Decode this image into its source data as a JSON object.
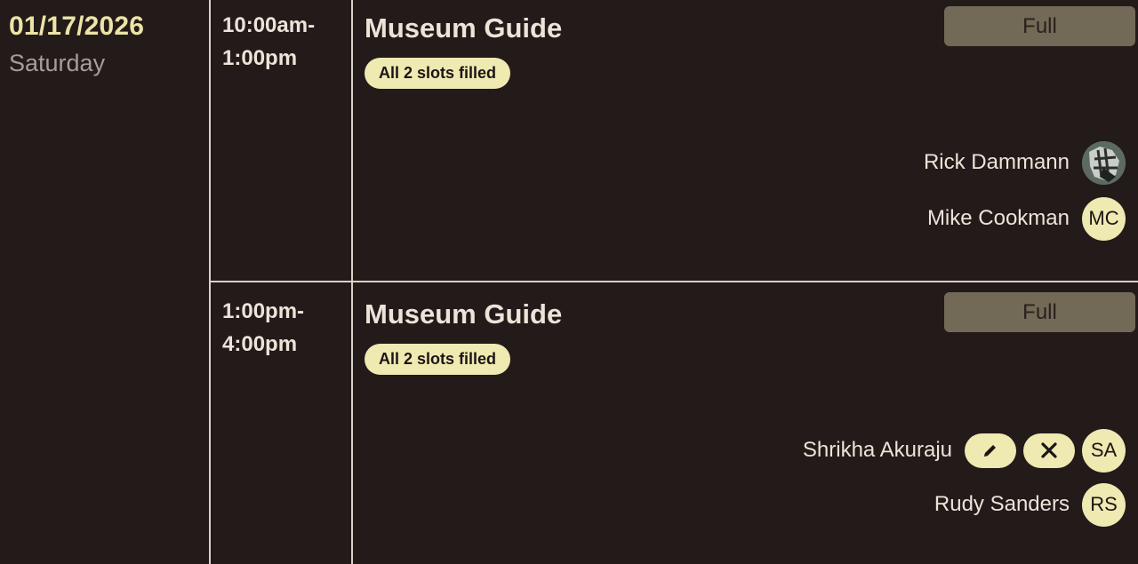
{
  "date": {
    "value": "01/17/2026",
    "weekday": "Saturday"
  },
  "shifts": [
    {
      "time": "10:00am-\n1:00pm",
      "title": "Museum Guide",
      "status_pill": "All 2 slots filled",
      "action_label": "Full",
      "volunteers": [
        {
          "name": "Rick Dammann",
          "initials": "",
          "avatar": "photo"
        },
        {
          "name": "Mike Cookman",
          "initials": "MC"
        }
      ]
    },
    {
      "time": "1:00pm-\n4:00pm",
      "title": "Museum Guide",
      "status_pill": "All 2 slots filled",
      "action_label": "Full",
      "volunteers": [
        {
          "name": "Shrikha Akuraju",
          "initials": "SA",
          "actions": [
            "edit-icon",
            "close-icon"
          ]
        },
        {
          "name": "Rudy Sanders",
          "initials": "RS"
        }
      ]
    }
  ],
  "colors": {
    "background": "#231a1a",
    "accent": "#efe9b2",
    "date_text": "#ece3a6",
    "button": "#726a57",
    "divider": "#d8d2c8"
  }
}
